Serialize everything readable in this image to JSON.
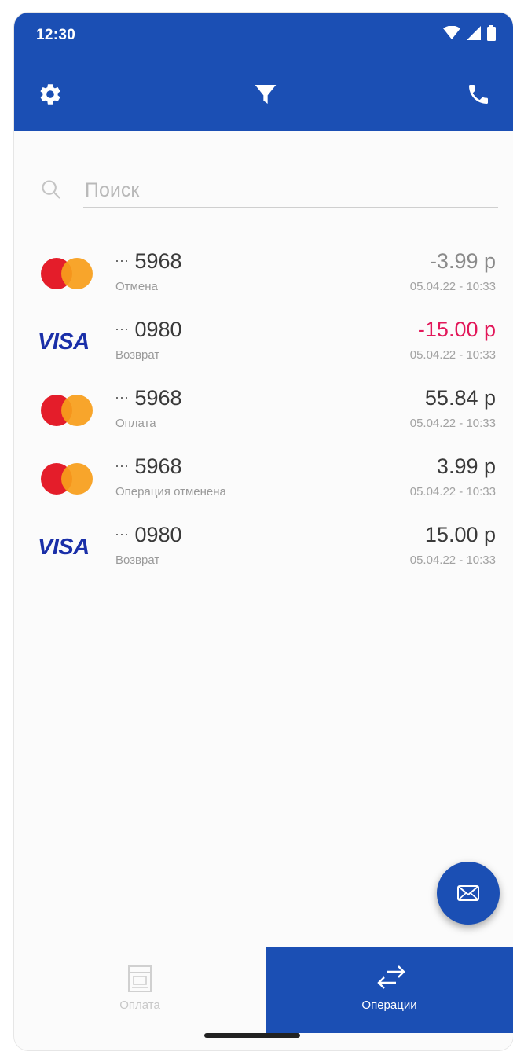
{
  "status_bar": {
    "time": "12:30"
  },
  "toolbar": {
    "settings_icon": "gear-icon",
    "filter_icon": "filter-icon",
    "phone_icon": "phone-icon",
    "color": "#1b4fb4"
  },
  "search": {
    "placeholder": "Поиск",
    "value": ""
  },
  "transactions": [
    {
      "brand": "mastercard",
      "pan": "5968",
      "description": "Отмена",
      "amount": "-3.99 р",
      "amount_color": "#8a8a8a",
      "date": "05.04.22 - 10:33"
    },
    {
      "brand": "visa",
      "brand_text": "VISA",
      "pan": "0980",
      "description": "Возврат",
      "amount": "-15.00 р",
      "amount_color": "#e2185a",
      "date": "05.04.22 - 10:33"
    },
    {
      "brand": "mastercard",
      "pan": "5968",
      "description": "Оплата",
      "amount": "55.84 р",
      "amount_color": "#3a3a3a",
      "date": "05.04.22 - 10:33"
    },
    {
      "brand": "mastercard",
      "pan": "5968",
      "description": "Операция отменена",
      "amount": "3.99 р",
      "amount_color": "#3a3a3a",
      "date": "05.04.22 - 10:33"
    },
    {
      "brand": "visa",
      "brand_text": "VISA",
      "pan": "0980",
      "description": "Возврат",
      "amount": "15.00 р",
      "amount_color": "#3a3a3a",
      "date": "05.04.22 - 10:33"
    }
  ],
  "pan_prefix": "···",
  "fab": {
    "icon": "mail-icon"
  },
  "bottom_nav": {
    "items": [
      {
        "label": "Оплата",
        "icon": "terminal-icon",
        "active": false
      },
      {
        "label": "Операции",
        "icon": "swap-arrows-icon",
        "active": true
      }
    ]
  }
}
